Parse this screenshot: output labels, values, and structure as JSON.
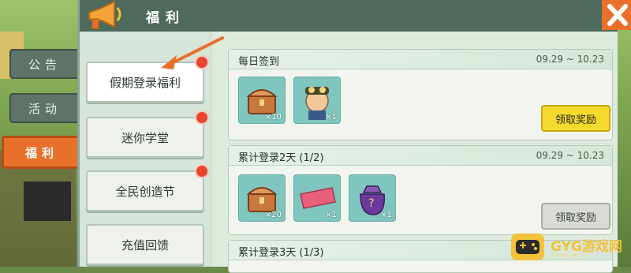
{
  "header": {
    "title": "福利"
  },
  "categories": [
    {
      "label": "公告",
      "active": false
    },
    {
      "label": "活动",
      "active": false
    },
    {
      "label": "福利",
      "active": true
    }
  ],
  "side_list": [
    {
      "label": "假期登录福利",
      "selected": true
    },
    {
      "label": "迷你学堂",
      "selected": false
    },
    {
      "label": "全民创造节",
      "selected": false
    },
    {
      "label": "充值回馈",
      "selected": false
    }
  ],
  "cards": [
    {
      "title": "每日签到",
      "date": "09.29 ~ 10.23",
      "items": [
        {
          "icon": "treasure-chest-icon",
          "qty": "×10"
        },
        {
          "icon": "character-avatar-icon",
          "qty": "×1"
        }
      ],
      "button": {
        "label": "领取奖励",
        "state": "active"
      }
    },
    {
      "title": "累计登录2天 (1/2)",
      "date": "09.29 ~ 10.23",
      "items": [
        {
          "icon": "treasure-chest-icon",
          "qty": "×20"
        },
        {
          "icon": "mini-ticket-icon",
          "qty": "×1"
        },
        {
          "icon": "mystery-bag-icon",
          "qty": "×1"
        }
      ],
      "button": {
        "label": "领取奖励",
        "state": "disabled"
      }
    },
    {
      "title": "累计登录3天 (1/3)",
      "date": "",
      "items": [],
      "button": null
    }
  ],
  "watermark": {
    "text": "GYG游戏网",
    "sub": "GAME BOX"
  },
  "colors": {
    "accent_orange": "#e8702a",
    "claim_yellow": "#f4d92e",
    "header_green": "#4e6a5c"
  }
}
